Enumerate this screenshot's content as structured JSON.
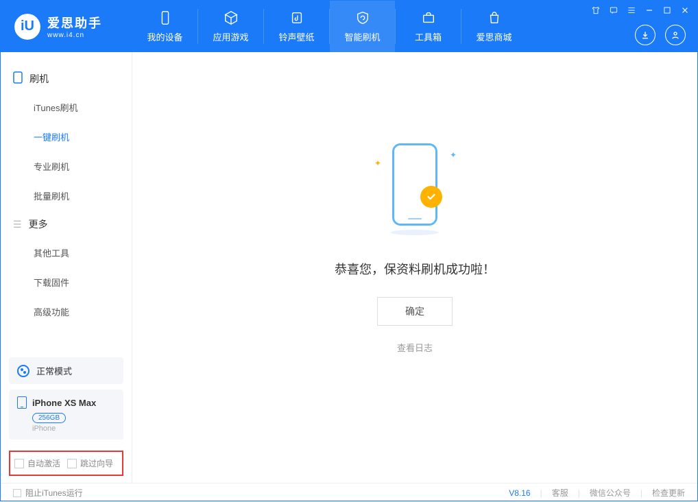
{
  "app": {
    "name": "爱思助手",
    "domain": "www.i4.cn"
  },
  "nav": {
    "my_device": "我的设备",
    "app_games": "应用游戏",
    "ring_wall": "铃声壁纸",
    "smart_flash": "智能刷机",
    "toolbox": "工具箱",
    "store": "爱思商城"
  },
  "sidebar": {
    "group_flash": "刷机",
    "items_flash": [
      "iTunes刷机",
      "一键刷机",
      "专业刷机",
      "批量刷机"
    ],
    "group_more": "更多",
    "items_more": [
      "其他工具",
      "下载固件",
      "高级功能"
    ]
  },
  "mode": {
    "label": "正常模式"
  },
  "device": {
    "name": "iPhone XS Max",
    "capacity": "256GB",
    "type": "iPhone"
  },
  "highlight": {
    "auto_activate": "自动激活",
    "skip_guide": "跳过向导"
  },
  "main": {
    "success_text": "恭喜您，保资料刷机成功啦！",
    "ok": "确定",
    "view_log": "查看日志"
  },
  "statusbar": {
    "block_itunes": "阻止iTunes运行",
    "version": "V8.16",
    "service": "客服",
    "wechat": "微信公众号",
    "check_update": "检查更新"
  }
}
